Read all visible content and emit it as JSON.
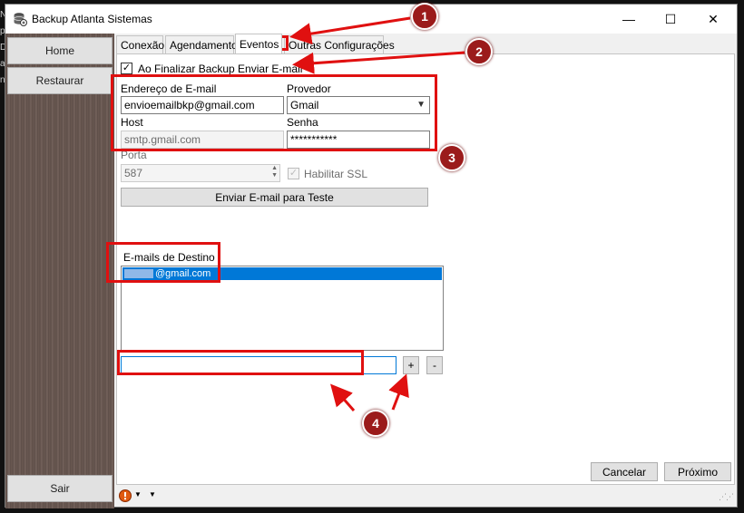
{
  "background_fragment": [
    "N",
    "p",
    "D",
    "a",
    "ni"
  ],
  "window": {
    "title": "Backup Atlanta Sistemas",
    "controls": {
      "minimize": "—",
      "maximize": "☐",
      "close": "✕"
    }
  },
  "sidebar": {
    "home": "Home",
    "restore": "Restaurar",
    "exit": "Sair"
  },
  "tabs": [
    "Conexão",
    "Agendamento",
    "Eventos",
    "Outras Configurações"
  ],
  "active_tab": "Eventos",
  "events": {
    "send_email_checkbox": {
      "label": "Ao Finalizar Backup Enviar E-mail",
      "checked": true
    },
    "email_label": "Endereço de E-mail",
    "email_value": "envioemailbkp@gmail.com",
    "provider_label": "Provedor",
    "provider_value": "Gmail",
    "host_label": "Host",
    "host_value": "smtp.gmail.com",
    "password_label": "Senha",
    "password_value": "***********",
    "port_label": "Porta",
    "port_value": "587",
    "ssl_label": "Habilitar SSL",
    "test_button": "Enviar E-mail para Teste",
    "recipients_label": "E-mails de Destino",
    "recipients": [
      "@gmail.com"
    ],
    "new_recipient_value": "",
    "add_button": "+",
    "remove_button": "-"
  },
  "footer": {
    "cancel": "Cancelar",
    "next": "Próximo"
  },
  "annotations": {
    "badges": [
      "1",
      "2",
      "3",
      "4"
    ],
    "color": "#e01010"
  }
}
